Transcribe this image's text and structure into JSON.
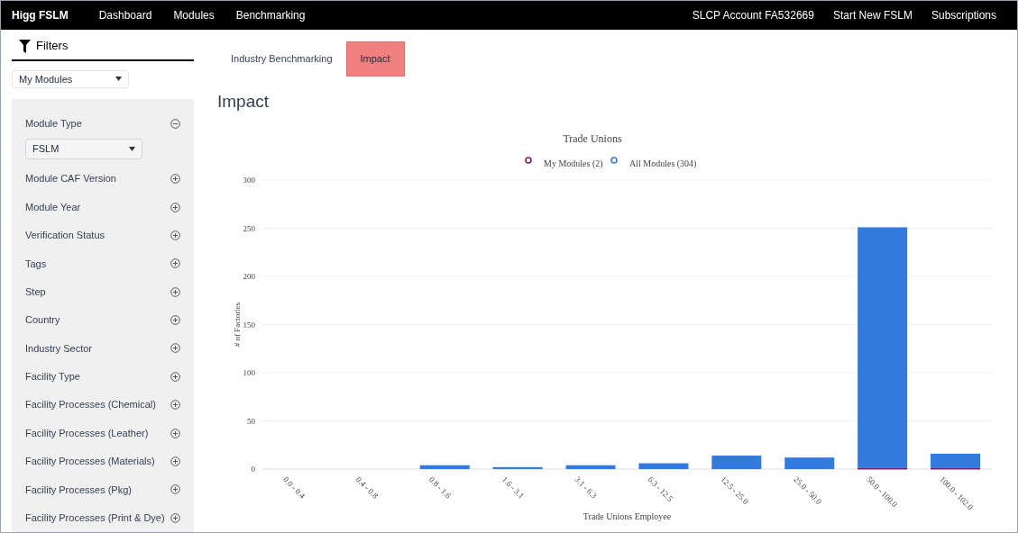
{
  "navbar": {
    "brand": "Higg FSLM",
    "left_links": [
      "Dashboard",
      "Modules",
      "Benchmarking"
    ],
    "right_links": [
      "SLCP Account FA532669",
      "Start New FSLM",
      "Subscriptions"
    ]
  },
  "filters": {
    "title": "Filters",
    "scope_select": "My Modules",
    "items": [
      {
        "label": "Module Type",
        "expanded": true,
        "select": "FSLM"
      },
      {
        "label": "Module CAF Version",
        "expanded": false
      },
      {
        "label": "Module Year",
        "expanded": false
      },
      {
        "label": "Verification Status",
        "expanded": false
      },
      {
        "label": "Tags",
        "expanded": false
      },
      {
        "label": "Step",
        "expanded": false
      },
      {
        "label": "Country",
        "expanded": false
      },
      {
        "label": "Industry Sector",
        "expanded": false
      },
      {
        "label": "Facility Type",
        "expanded": false
      },
      {
        "label": "Facility Processes (Chemical)",
        "expanded": false
      },
      {
        "label": "Facility Processes (Leather)",
        "expanded": false
      },
      {
        "label": "Facility Processes (Materials)",
        "expanded": false
      },
      {
        "label": "Facility Processes (Pkg)",
        "expanded": false
      },
      {
        "label": "Facility Processes (Print & Dye)",
        "expanded": false
      }
    ]
  },
  "tabs": [
    {
      "label": "Industry Benchmarking",
      "selected": false
    },
    {
      "label": "Impact",
      "selected": true
    }
  ],
  "heading": "Impact",
  "chart_data": {
    "type": "bar",
    "title": "Trade Unions",
    "xlabel": "Trade Unions Employee",
    "ylabel": "# of Factories",
    "categories": [
      "0.0 - 0.4",
      "0.4 - 0.8",
      "0.8 - 1.6",
      "1.6 - 3.1",
      "3.1 - 6.3",
      "6.3 - 12.5",
      "12.5 - 25.0",
      "25.0 - 50.0",
      "50.0 - 100.0",
      "100.0 - 102.0"
    ],
    "series": [
      {
        "name": "My Modules (2)",
        "color": "#7b1a6b",
        "values": [
          0,
          0,
          0,
          0,
          0,
          0,
          0,
          0,
          1,
          1
        ]
      },
      {
        "name": "All Modules (304)",
        "color": "#327ade",
        "values": [
          0,
          0,
          4,
          2,
          4,
          6,
          14,
          12,
          250,
          15
        ]
      }
    ],
    "ylim": [
      0,
      300
    ],
    "yticks": [
      0,
      50,
      100,
      150,
      200,
      250,
      300
    ],
    "stacked": true,
    "grid": true,
    "legend": true
  }
}
